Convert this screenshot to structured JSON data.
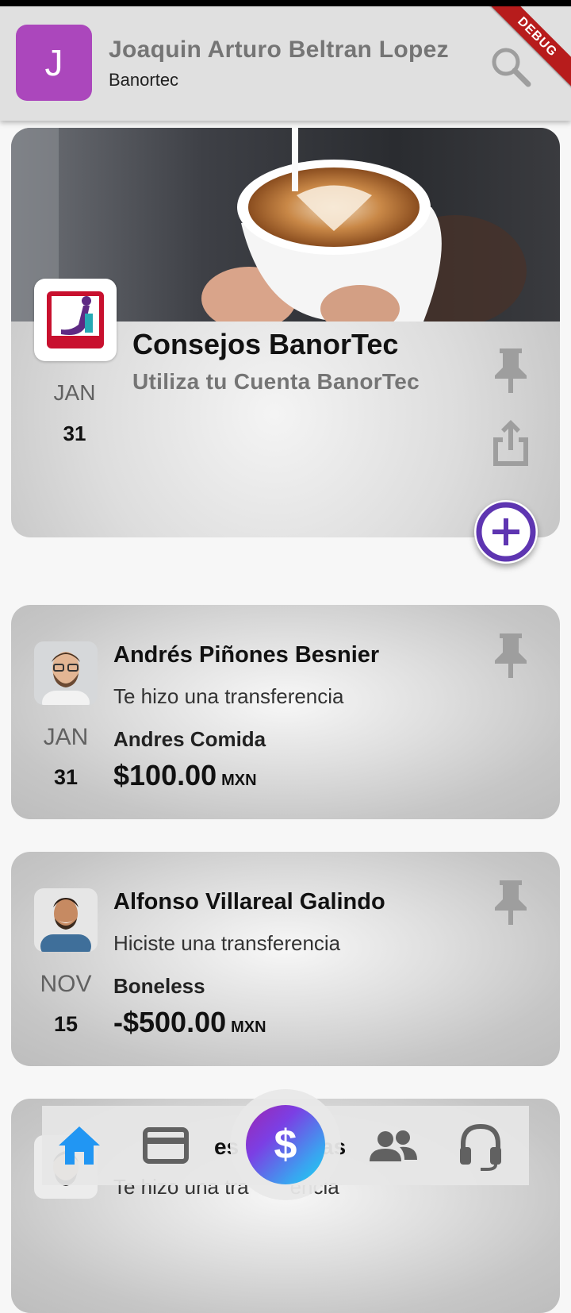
{
  "app_bar": {
    "avatar_letter": "J",
    "user_name": "Joaquin Arturo Beltran Lopez",
    "org_name": "Banortec",
    "search_icon": "search-icon",
    "debug_label": "DEBUG"
  },
  "colors": {
    "avatar_bg": "#ab47bc",
    "fab_ring": "#5e35b1",
    "debug_ribbon": "#b71c1c",
    "nav_active": "#2196f3",
    "nav_inactive": "#616161"
  },
  "promo": {
    "logo_text": "BANORTE",
    "title": "Consejos BanorTec",
    "subtitle": "Utiliza tu Cuenta BanorTec",
    "month": "JAN",
    "day": "31",
    "icons": [
      "pin-icon",
      "share-icon",
      "add-icon"
    ]
  },
  "transactions": [
    {
      "name": "Andrés Piñones Besnier",
      "action": "Te hizo una transferencia",
      "month": "JAN",
      "day": "31",
      "concept": "Andres Comida",
      "amount": "$100.00",
      "currency": "MXN"
    },
    {
      "name": "Alfonso Villareal Galindo",
      "action": "Hiciste una transferencia",
      "month": "NOV",
      "day": "15",
      "concept": "Boneless",
      "amount": "-$500.00",
      "currency": "MXN"
    },
    {
      "name_fragment_left": "es",
      "name_fragment_right": "as",
      "action": "Te hizo una tra",
      "action_tail": "encia"
    }
  ],
  "bottom_nav": {
    "items": [
      "home-icon",
      "card-icon",
      "dollar-icon",
      "people-icon",
      "headset-icon"
    ],
    "active": "home-icon",
    "center_label": "$"
  }
}
